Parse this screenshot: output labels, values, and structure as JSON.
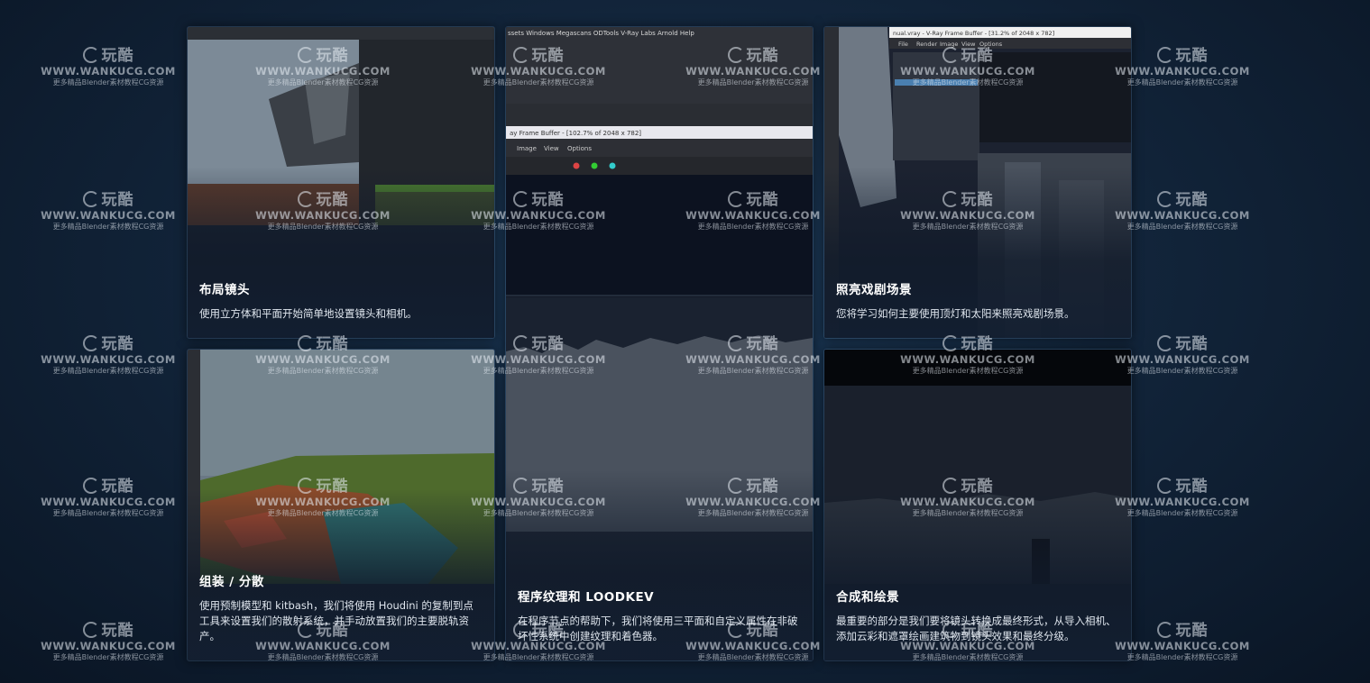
{
  "cards": [
    {
      "title": "布局镜头",
      "desc": "使用立方体和平面开始简单地设置镜头和相机。"
    },
    {
      "title": "程序纹理和 LOODKEV",
      "desc": "在程序节点的帮助下，我们将使用三平面和自定义属性在非破坏性系统中创建纹理和着色器。"
    },
    {
      "title": "照亮戏剧场景",
      "desc": "您将学习如何主要使用顶灯和太阳来照亮戏剧场景。"
    },
    {
      "title": "组装 / 分散",
      "desc": "使用预制模型和 kitbash，我们将使用 Houdini 的复制到点工具来设置我们的散射系统，并手动放置我们的主要脱轨资产。"
    },
    {
      "title": "合成和绘景",
      "desc": "最重要的部分是我们要将镜头转换成最终形式，从导入相机、添加云彩和遮罩绘画建筑物到镜头效果和最终分级。"
    }
  ],
  "screens": {
    "card2_menu": "ssets  Windows  Megascans  ODTools  V-Ray  Labs  Arnold  Help",
    "card2_fb_title": "ay Frame Buffer - [102.7% of 2048 x 782]",
    "card2_fb_menu": [
      "Image",
      "View",
      "Options"
    ],
    "card3_fb_title": "nual.vray - V-Ray Frame Buffer - [31.2% of 2048 x 782]",
    "card3_fb_menu": [
      "File",
      "Render",
      "Image",
      "View",
      "Options"
    ]
  },
  "watermark": {
    "logo": "玩酷",
    "url": "WWW.WANKUCG.COM",
    "sub": "更多精品Blender素材教程CG资源"
  }
}
